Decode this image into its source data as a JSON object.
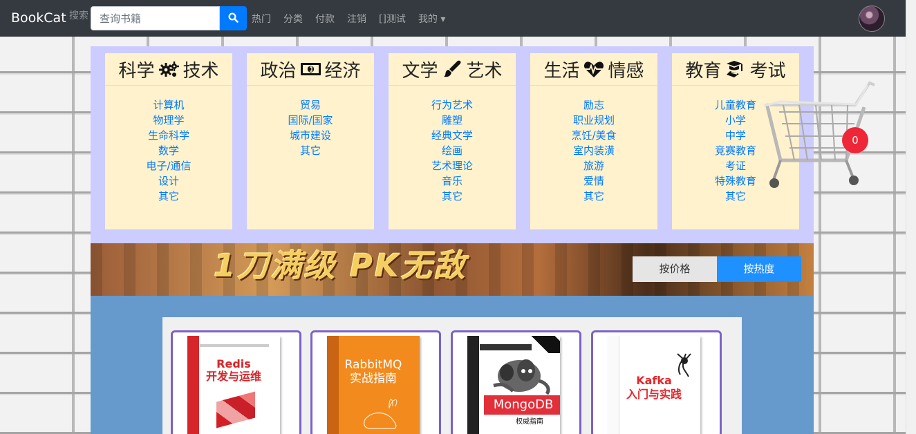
{
  "navbar": {
    "brand": "BookCat",
    "search_label": "搜索",
    "search_placeholder": "查询书籍",
    "links": [
      "热门",
      "分类",
      "付款",
      "注销",
      "[]测试",
      "我的 ▾"
    ]
  },
  "categories": [
    {
      "title_left": "科学",
      "icon": "gears-icon",
      "title_right": "技术",
      "items": [
        "计算机",
        "物理学",
        "生命科学",
        "数学",
        "电子/通信",
        "设计",
        "其它"
      ]
    },
    {
      "title_left": "政治",
      "icon": "money-bill-icon",
      "title_right": "经济",
      "items": [
        "贸易",
        "国际/国家",
        "城市建设",
        "其它"
      ]
    },
    {
      "title_left": "文学",
      "icon": "paintbrush-icon",
      "title_right": "艺术",
      "items": [
        "行为艺术",
        "雕塑",
        "经典文学",
        "绘画",
        "艺术理论",
        "音乐",
        "其它"
      ]
    },
    {
      "title_left": "生活",
      "icon": "heartbeat-icon",
      "title_right": "情感",
      "items": [
        "励志",
        "职业规划",
        "烹饪/美食",
        "室内装潢",
        "旅游",
        "爱情",
        "其它"
      ]
    },
    {
      "title_left": "教育",
      "icon": "graduation-cap-icon",
      "title_right": "考试",
      "items": [
        "儿童教育",
        "小学",
        "中学",
        "竞赛教育",
        "考证",
        "特殊教育",
        "其它"
      ]
    }
  ],
  "banner": {
    "text": "1刀满级 PK无敌",
    "sort_price": "按价格",
    "sort_popular": "按热度"
  },
  "cart": {
    "count": "0",
    "icon": "shopping-cart-icon"
  },
  "books": [
    {
      "cover_title": "Redis\n开发与运维",
      "spine": "Redis 开发与运维",
      "accent": "#d7262a"
    },
    {
      "cover_title": "RabbitMQ\n实战指南",
      "spine": "RabbitMQ 实战指南",
      "accent": "#f28a1d"
    },
    {
      "cover_title": "MongoDB",
      "subtitle": "权威指南",
      "spine": "MongoDB权威指南",
      "accent": "#e22f3a"
    },
    {
      "cover_title": "Kafka\n入门与实践",
      "spine": "Kafka入门与实践",
      "accent": "#e5262a"
    }
  ]
}
